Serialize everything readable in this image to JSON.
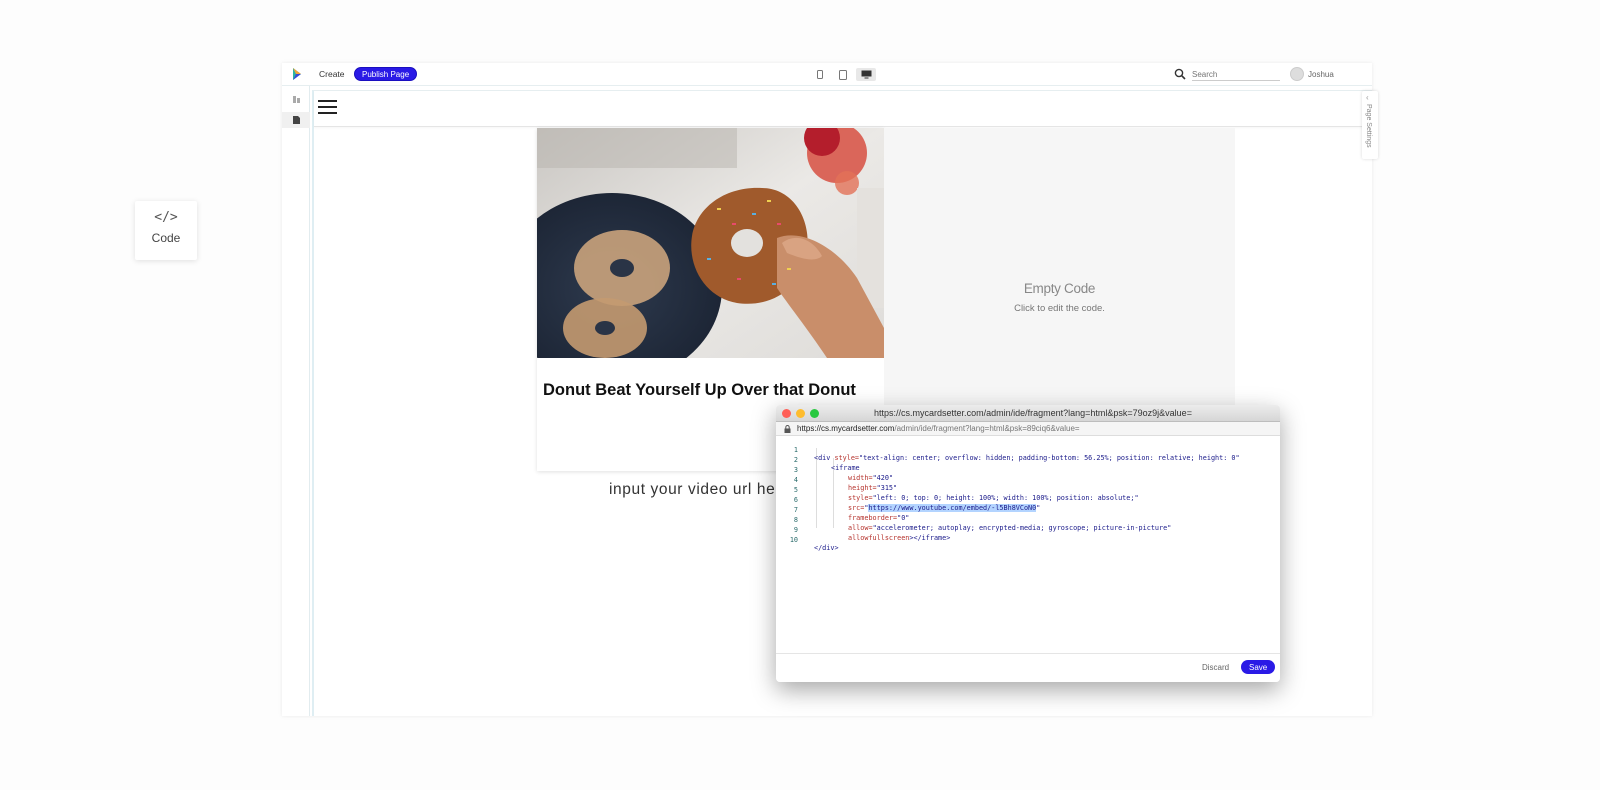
{
  "code_widget": {
    "glyph": "</>",
    "label": "Code"
  },
  "topbar": {
    "create_label": "Create",
    "publish_label": "Publish Page",
    "search_placeholder": "Search",
    "user_name": "Joshua",
    "accent_color": "#2a1ae6"
  },
  "card": {
    "title": "Donut Beat Yourself Up Over that Donut"
  },
  "empty_code": {
    "title": "Empty Code",
    "subtitle": "Click to edit the code."
  },
  "page_settings": {
    "label": "Page Settings"
  },
  "annotation": {
    "text": "input your video url here"
  },
  "editor": {
    "window_title": "https://cs.mycardsetter.com/admin/ide/fragment?lang=html&psk=79oz9j&value=",
    "url_host": "https://cs.mycardsetter.com",
    "url_path": "/admin/ide/fragment?lang=html&psk=89ciq6&value=",
    "lines": [
      {
        "n": "1"
      },
      {
        "n": "2"
      },
      {
        "n": "3"
      },
      {
        "n": "4"
      },
      {
        "n": "5"
      },
      {
        "n": "6"
      },
      {
        "n": "7"
      },
      {
        "n": "8"
      },
      {
        "n": "9"
      },
      {
        "n": "10"
      }
    ],
    "code": {
      "l1_tag": "<div",
      "l1_attr": " style=",
      "l1_val": "\"text-align: center; overflow: hidden; padding-bottom: 56.25%; position: relative; height: 0\"",
      "l2_tag": "<iframe",
      "l3_attr": "width=",
      "l3_val": "\"420\"",
      "l4_attr": "height=",
      "l4_val": "\"315\"",
      "l5_attr": "style=",
      "l5_val": "\"left: 0; top: 0; height: 100%; width: 100%; position: absolute;\"",
      "l6_attr": "src=",
      "l6_q1": "\"",
      "l6_url": "https://www.youtube.com/embed/-l5Bh8VCoN0",
      "l6_q2": "\"",
      "l7_attr": "frameborder=",
      "l7_val": "\"0\"",
      "l8_attr": "allow=",
      "l8_val": "\"accelerometer; autoplay; encrypted-media; gyroscope; picture-in-picture\"",
      "l9_attr": "allowfullscreen",
      "l9_tag": "></iframe>",
      "l10_tag": "</div>"
    },
    "discard_label": "Discard",
    "save_label": "Save"
  }
}
